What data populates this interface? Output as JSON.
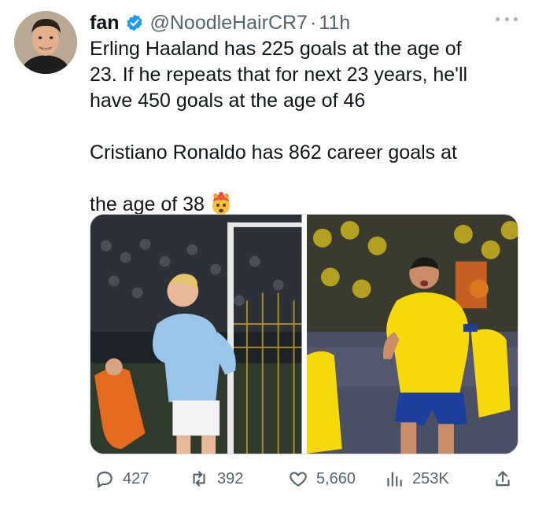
{
  "tweet": {
    "author": {
      "name": "fan",
      "handle": "@NoodleHairCR7",
      "separator": "·",
      "time": "11h"
    },
    "text": {
      "paragraph_1": "Erling Haaland has 225 goals at the age of\n23. If he repeats that for next 23 years, he'll\nhave 450 goals at the age of 46",
      "paragraph_2": "Cristiano Ronaldo has 862 career goals at\nthe age of 38"
    },
    "stats": {
      "replies": "427",
      "reposts": "392",
      "likes": "5,660",
      "views": "253K"
    }
  },
  "colors": {
    "verified": "#1d9bf0",
    "text_primary": "#0f1419",
    "text_secondary": "#536471",
    "city_kit": "#98c5e9",
    "nassr_kit": "#f5d90a",
    "nassr_shorts": "#1c3f9e"
  },
  "icons": {
    "verified": "verified-badge-icon",
    "more": "more-dots-icon",
    "emoji": "exploding-head-emoji",
    "reply": "reply-bubble-icon",
    "repost": "repost-arrows-icon",
    "like": "heart-icon",
    "views": "views-bars-icon",
    "share": "share-upload-icon"
  }
}
